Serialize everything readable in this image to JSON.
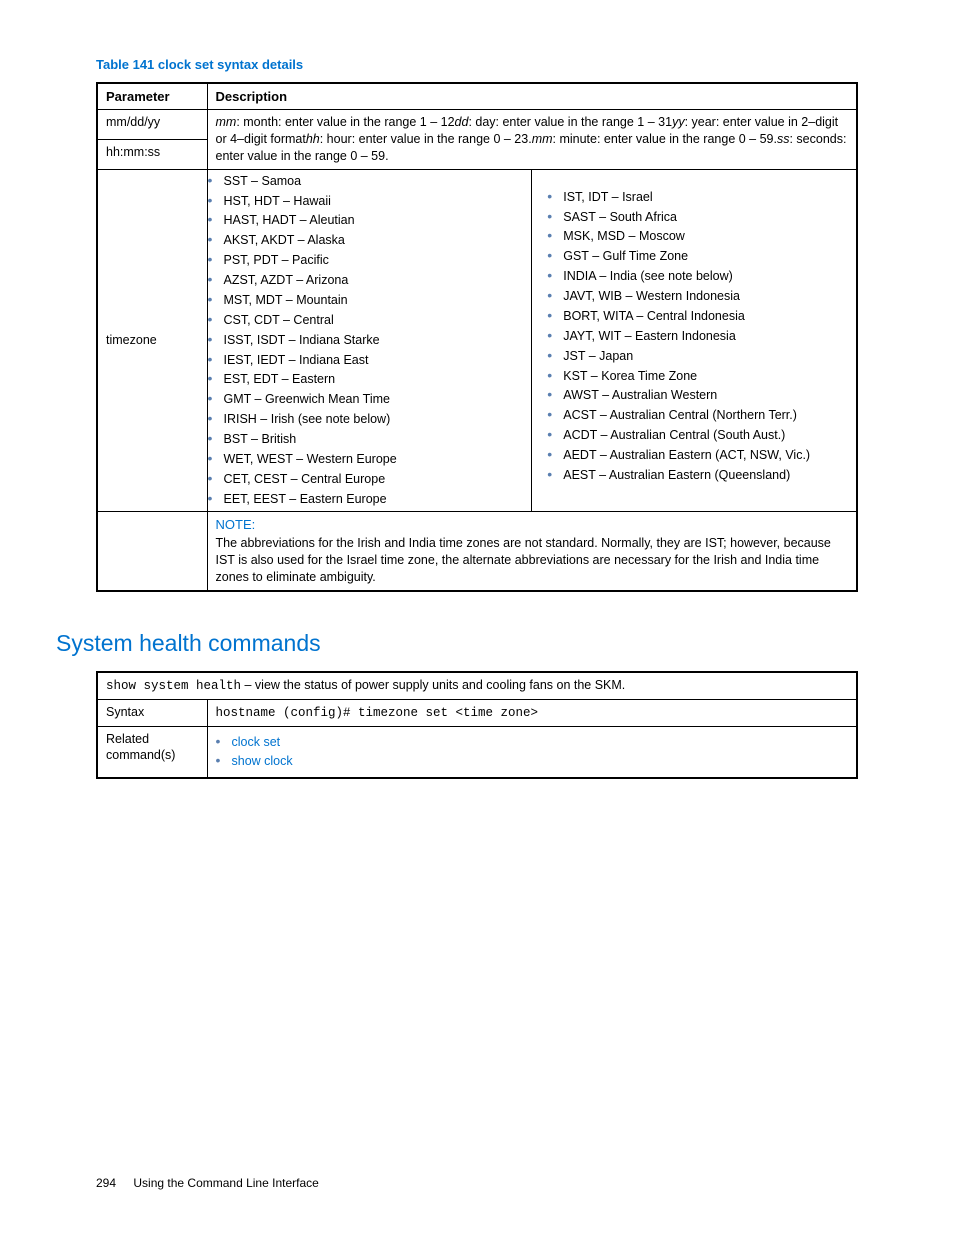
{
  "table141": {
    "title": "Table 141 clock set syntax details",
    "head_param": "Parameter",
    "head_desc": "Description",
    "row1": {
      "param": "mm/dd/yy"
    },
    "row2": {
      "param": "hh:mm:ss"
    },
    "desc_lines": {
      "l1a": "mm",
      "l1b": ": month: enter value in the range 1 – 12",
      "l1c": "dd",
      "l1d": ": day: enter value in the range 1 – 31",
      "l2a": "yy",
      "l2b": ": year: enter value in 2–digit or 4–digit format",
      "l2c": "hh",
      "l2d": ": hour: enter value in the range 0 – 23.",
      "l3a": "mm",
      "l3b": ": minute: enter value in the range 0 – 59.",
      "l3c": "ss",
      "l3d": ": seconds: enter value in the range 0 – 59."
    },
    "tz_label": "timezone",
    "tz_left": [
      "SST – Samoa",
      "HST, HDT – Hawaii",
      "HAST, HADT – Aleutian",
      "AKST, AKDT – Alaska",
      "PST, PDT – Pacific",
      "AZST, AZDT – Arizona",
      "MST, MDT – Mountain",
      "CST, CDT – Central",
      "ISST, ISDT – Indiana Starke",
      "IEST, IEDT – Indiana East",
      "EST, EDT – Eastern",
      "GMT – Greenwich Mean Time",
      "IRISH – Irish (see note below)",
      "BST – British",
      "WET, WEST – Western Europe",
      "CET, CEST – Central Europe",
      "EET, EEST – Eastern Europe"
    ],
    "tz_right": [
      "IST, IDT – Israel",
      "SAST – South Africa",
      "MSK, MSD – Moscow",
      "GST – Gulf Time Zone",
      "INDIA – India (see note below)",
      "JAVT, WIB – Western Indonesia",
      "BORT, WITA – Central Indonesia",
      "JAYT, WIT – Eastern Indonesia",
      "JST – Japan",
      "KST – Korea Time Zone",
      "AWST – Australian Western",
      "ACST – Australian Central (Northern Terr.)",
      "ACDT – Australian Central (South Aust.)",
      "AEDT – Australian Eastern (ACT, NSW, Vic.)",
      "AEST – Australian Eastern (Queensland)"
    ],
    "note_label": "NOTE:",
    "note_body": "The abbreviations for the Irish and India time zones are not standard. Normally, they are IST; however, because IST is also used for the Israel time zone, the alternate abbreviations are necessary for the Irish and India time zones to eliminate ambiguity."
  },
  "section_title": "System health commands",
  "cmd_table": {
    "desc_code": "show system health",
    "desc_text": " – view the status of power supply units and cooling fans on the SKM.",
    "syntax_label": "Syntax",
    "syntax_value": "hostname (config)# timezone set <time zone>",
    "related_label": "Related command(s)",
    "related_links": [
      "clock set",
      "show clock"
    ]
  },
  "footer": {
    "page": "294",
    "chapter": "Using the Command Line Interface"
  }
}
